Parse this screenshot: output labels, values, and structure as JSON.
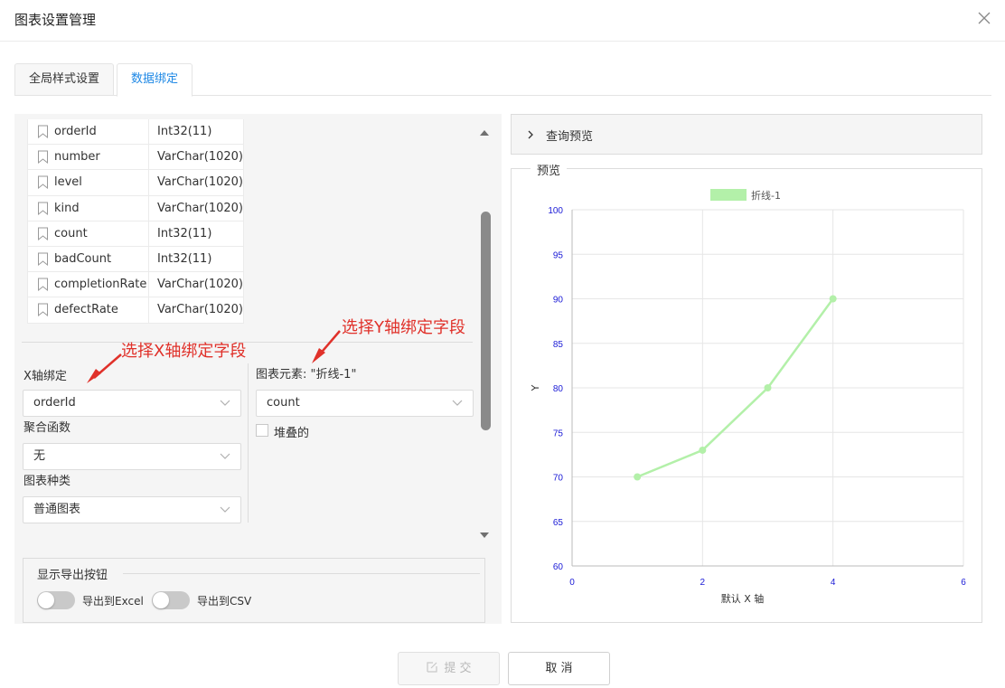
{
  "dialog": {
    "title": "图表设置管理"
  },
  "tabs": [
    {
      "label": "全局样式设置",
      "active": false
    },
    {
      "label": "数据绑定",
      "active": true
    }
  ],
  "fields": [
    {
      "name": "orderId",
      "type": "Int32(11)"
    },
    {
      "name": "number",
      "type": "VarChar(1020)"
    },
    {
      "name": "level",
      "type": "VarChar(1020)"
    },
    {
      "name": "kind",
      "type": "VarChar(1020)"
    },
    {
      "name": "count",
      "type": "Int32(11)"
    },
    {
      "name": "badCount",
      "type": "Int32(11)"
    },
    {
      "name": "completionRate",
      "type": "VarChar(1020)"
    },
    {
      "name": "defectRate",
      "type": "VarChar(1020)"
    }
  ],
  "xbind": {
    "label": "X轴绑定",
    "value": "orderId",
    "agg_label": "聚合函数",
    "agg_value": "无",
    "type_label": "图表种类",
    "type_value": "普通图表"
  },
  "ybind": {
    "label": "图表元素: \"折线-1\"",
    "value": "count",
    "stacked_label": "堆叠的"
  },
  "annotations": {
    "x": "选择X轴绑定字段",
    "y": "选择Y轴绑定字段"
  },
  "export": {
    "title": "显示导出按钮",
    "excel": "导出到Excel",
    "csv": "导出到CSV"
  },
  "query": {
    "label": "查询预览"
  },
  "preview": {
    "label": "预览"
  },
  "buttons": {
    "submit": "提 交",
    "cancel": "取 消"
  },
  "chart_data": {
    "type": "line",
    "series": [
      {
        "name": "折线-1",
        "x": [
          1,
          2,
          3,
          4
        ],
        "values": [
          70,
          73,
          80,
          90
        ]
      }
    ],
    "xlabel": "默认 X 轴",
    "ylabel": "Y",
    "xlim": [
      0,
      6
    ],
    "ylim": [
      60,
      100
    ],
    "xticks": [
      0,
      2,
      4,
      6
    ],
    "yticks": [
      60,
      65,
      70,
      75,
      80,
      85,
      90,
      95,
      100
    ],
    "grid": true,
    "legend": "top-center",
    "color": "#b3f0a9",
    "tick_color": "#1a1ad6"
  }
}
